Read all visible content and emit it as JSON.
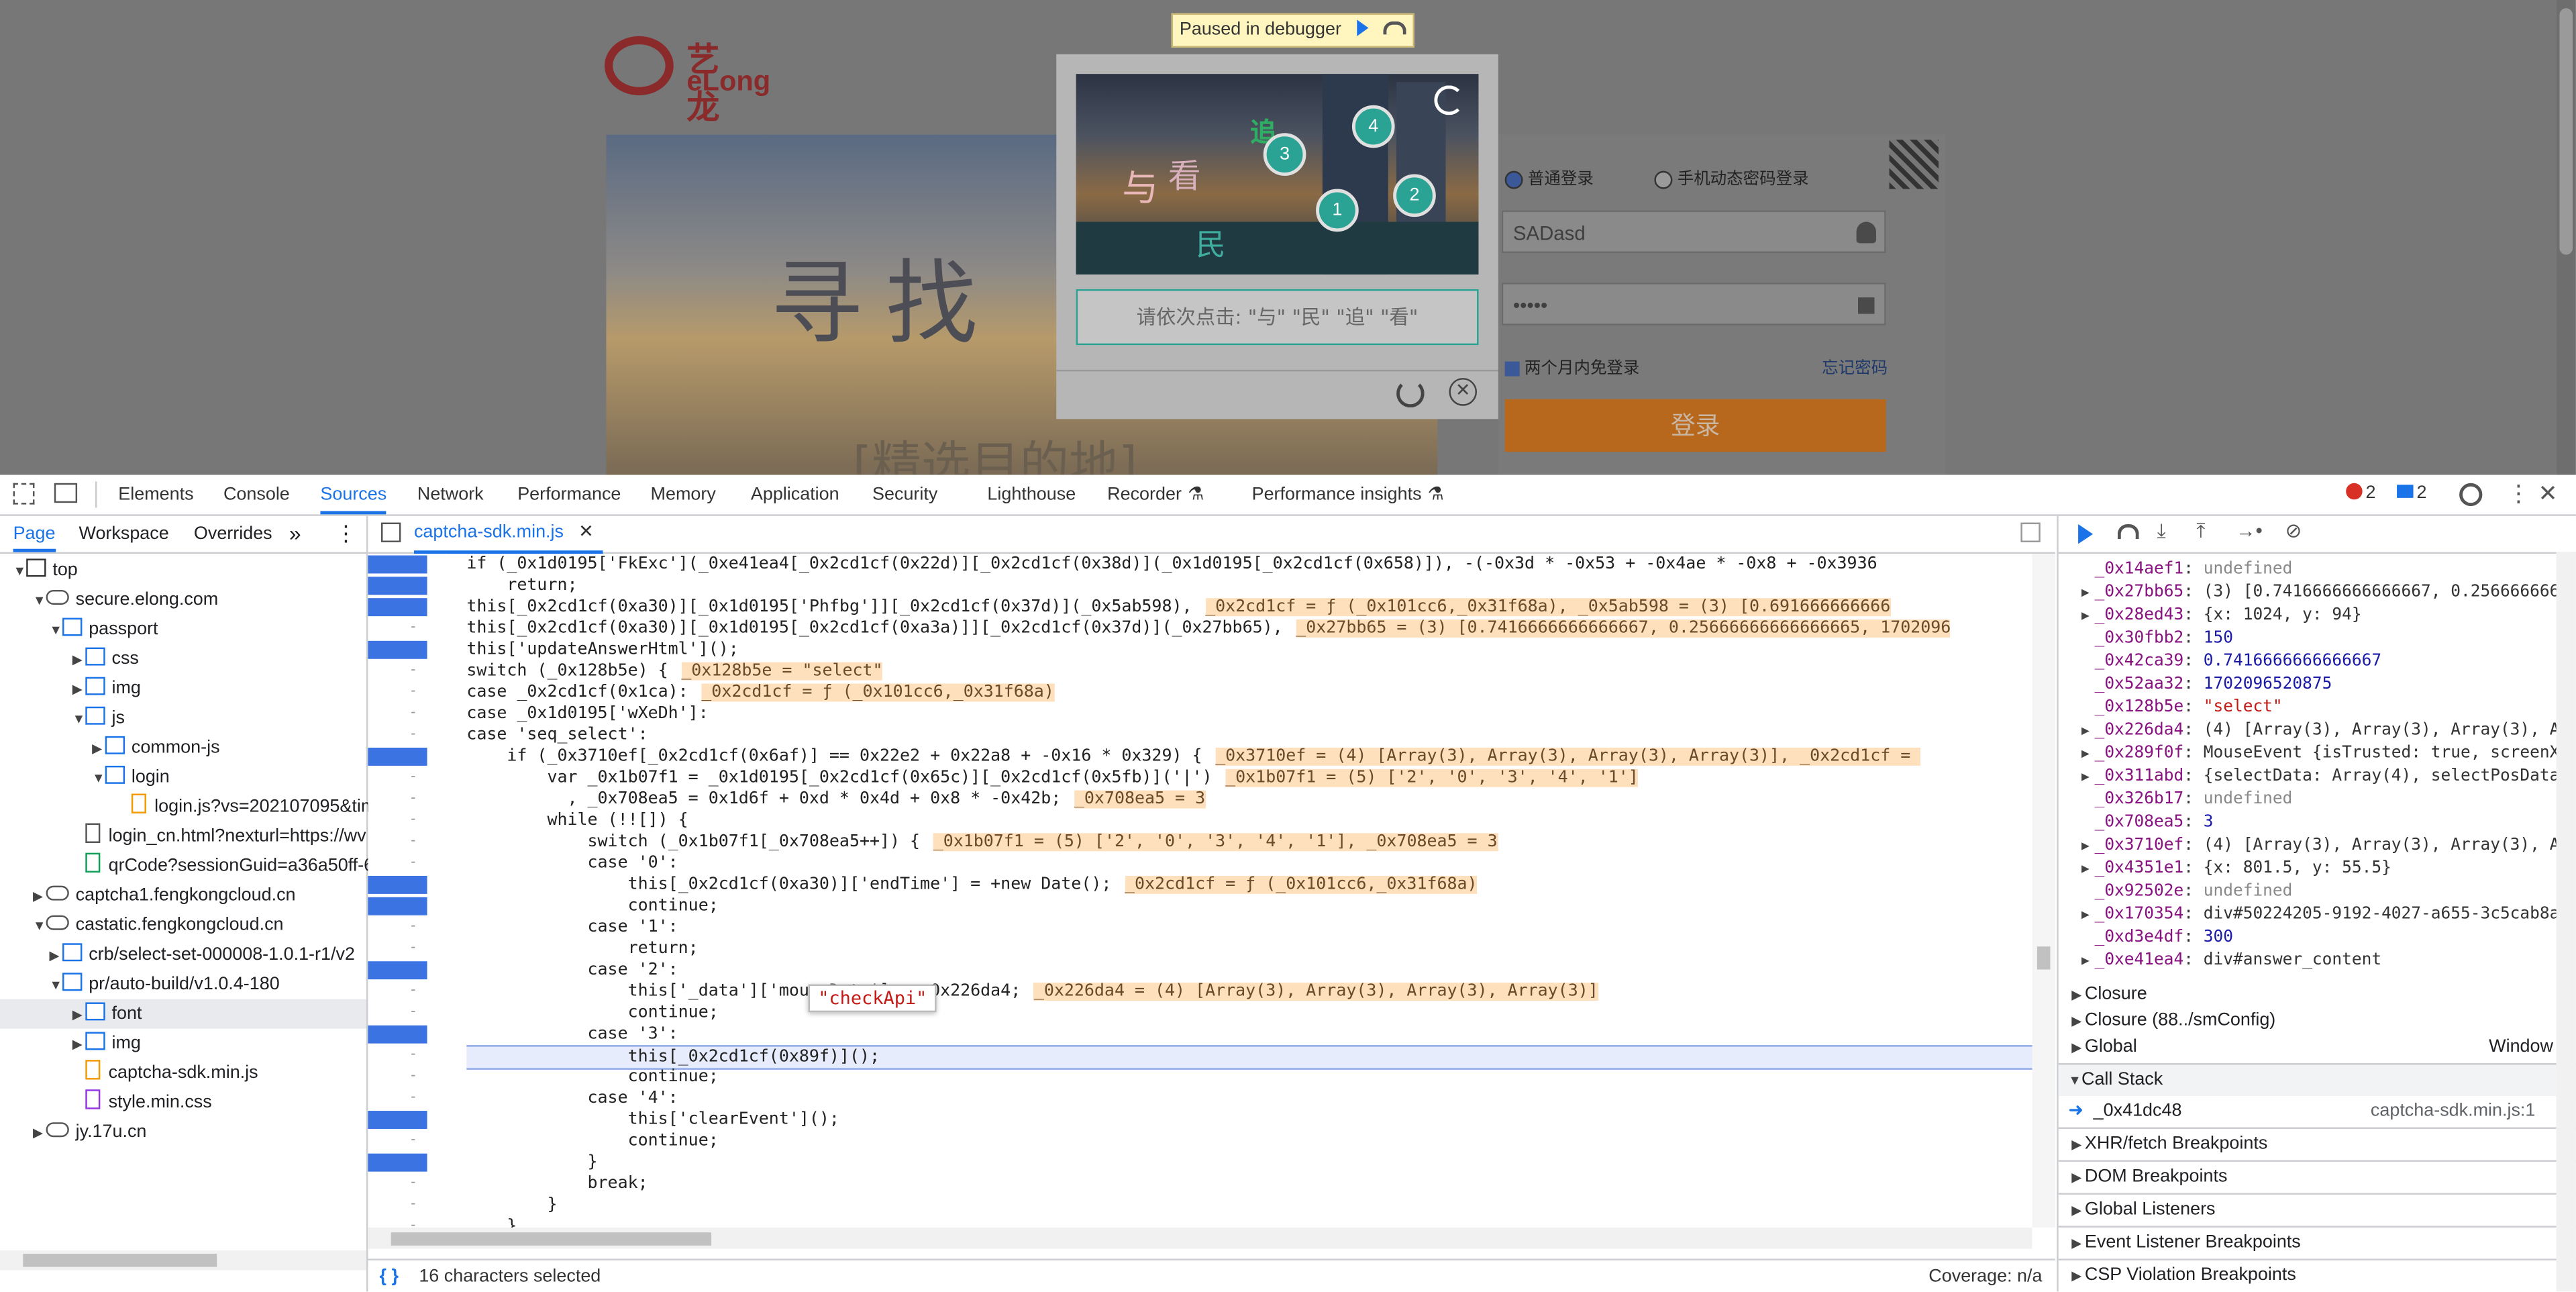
{
  "webpage": {
    "logo_cn": "艺龙",
    "logo_en": "eLong",
    "banner_text": "寻找  下",
    "banner_sub": "[精选目的地]",
    "radio_normal": "普通登录",
    "radio_sms": "手机动态密码登录",
    "username_value": "SADasd",
    "password_value": "•••••",
    "remember_label": "两个月内免登录",
    "forgot_label": "忘记密码",
    "login_button": "登录"
  },
  "debugger_banner": "Paused in debugger",
  "captcha": {
    "hint": "请依次点击: \"与\" \"民\" \"追\" \"看\"",
    "numbers": [
      "3",
      "4",
      "1",
      "2"
    ],
    "chars": [
      "追",
      "与",
      "看",
      "民"
    ]
  },
  "devtools": {
    "tabs": [
      "Elements",
      "Console",
      "Sources",
      "Network",
      "Performance",
      "Memory",
      "Application",
      "Security",
      "Lighthouse",
      "Recorder",
      "Performance insights"
    ],
    "selected_tab": "Sources",
    "error_count": "2",
    "message_count": "2",
    "navigator_tabs": [
      "Page",
      "Workspace",
      "Overrides"
    ],
    "tree": [
      {
        "label": "top",
        "kind": "frame"
      },
      {
        "label": "secure.elong.com",
        "kind": "cloud"
      },
      {
        "label": "passport",
        "kind": "folder"
      },
      {
        "label": "css",
        "kind": "folder"
      },
      {
        "label": "img",
        "kind": "folder"
      },
      {
        "label": "js",
        "kind": "folder"
      },
      {
        "label": "common-js",
        "kind": "folder"
      },
      {
        "label": "login",
        "kind": "folder"
      },
      {
        "label": "login.js?vs=202107095&tim",
        "kind": "js"
      },
      {
        "label": "login_cn.html?nexturl=https://wv",
        "kind": "html"
      },
      {
        "label": "qrCode?sessionGuid=a36a50ff-6",
        "kind": "img"
      },
      {
        "label": "captcha1.fengkongcloud.cn",
        "kind": "cloud"
      },
      {
        "label": "castatic.fengkongcloud.cn",
        "kind": "cloud"
      },
      {
        "label": "crb/select-set-000008-1.0.1-r1/v2",
        "kind": "folder"
      },
      {
        "label": "pr/auto-build/v1.0.4-180",
        "kind": "folder"
      },
      {
        "label": "font",
        "kind": "folder"
      },
      {
        "label": "img",
        "kind": "folder"
      },
      {
        "label": "captcha-sdk.min.js",
        "kind": "js"
      },
      {
        "label": "style.min.css",
        "kind": "css"
      },
      {
        "label": "jy.17u.cn",
        "kind": "cloud"
      }
    ],
    "open_file": "captcha-sdk.min.js",
    "code_lines": [
      "if (_0x1d0195['FkExc'](_0xe41ea4[_0x2cd1cf(0x22d)][_0x2cd1cf(0x38d)](_0x1d0195[_0x2cd1cf(0x658)]), -(-0x3d * -0x53 + -0x4ae * -0x8 + -0x3936",
      "    return;",
      "this[_0x2cd1cf(0xa30)][_0x1d0195['Phfbg']][_0x2cd1cf(0x37d)](_0x5ab598),",
      "this[_0x2cd1cf(0xa30)][_0x1d0195[_0x2cd1cf(0xa3a)]][_0x2cd1cf(0x37d)](_0x27bb65),",
      "this['updateAnswerHtml']();",
      "switch (_0x128b5e) {",
      "case _0x2cd1cf(0x1ca):",
      "case _0x1d0195['wXeDh']:",
      "case 'seq_select':",
      "    if (_0x3710ef[_0x2cd1cf(0x6af)] == 0x22e2 + 0x22a8 + -0x16 * 0x329) {",
      "        var _0x1b07f1 = _0x1d0195[_0x2cd1cf(0x65c)][_0x2cd1cf(0x5fb)]('|')",
      "          , _0x708ea5 = 0x1d6f + 0xd * 0x4d + 0x8 * -0x42b;",
      "        while (!![]) {",
      "            switch (_0x1b07f1[_0x708ea5++]) {",
      "            case '0':",
      "                this[_0x2cd1cf(0xa30)]['endTime'] = +new Date();",
      "                continue;",
      "            case '1':",
      "                return;",
      "            case '2':",
      "                this['_data']['mouseData'] = _0x226da4;",
      "                continue;",
      "            case '3':",
      "                this[_0x2cd1cf(0x89f)]();",
      "                continue;",
      "            case '4':",
      "                this['clearEvent']();",
      "                continue;",
      "            }",
      "            break;",
      "        }",
      "    }"
    ],
    "inline_values": [
      "",
      "",
      "_0x2cd1cf = ƒ (_0x101cc6,_0x31f68a), _0x5ab598 = (3) [0.691666666666",
      "_0x27bb65 = (3) [0.7416666666666667, 0.25666666666666665, 1702096",
      "",
      "_0x128b5e = \"select\"",
      "_0x2cd1cf = ƒ (_0x101cc6,_0x31f68a)",
      "",
      "",
      "_0x3710ef = (4) [Array(3), Array(3), Array(3), Array(3)], _0x2cd1cf = ",
      "_0x1b07f1 = (5) ['2', '0', '3', '4', '1']",
      "_0x708ea5 = 3",
      "",
      "_0x1b07f1 = (5) ['2', '0', '3', '4', '1'], _0x708ea5 = 3",
      "",
      "_0x2cd1cf = ƒ (_0x101cc6,_0x31f68a)",
      "",
      "",
      "",
      "",
      "_0x226da4 = (4) [Array(3), Array(3), Array(3), Array(3)]",
      "",
      "",
      "",
      "",
      "",
      "",
      "",
      "",
      "",
      "",
      ""
    ],
    "tooltip": "\"checkApi\"",
    "status_selected": "16 characters selected",
    "coverage": "Coverage: n/a",
    "scope_vars": [
      {
        "key": "_0x14aef1",
        "val": "undefined",
        "exp": false
      },
      {
        "key": "_0x27bb65",
        "val": "(3) [0.7416666666666667, 0.2566666666",
        "exp": true
      },
      {
        "key": "_0x28ed43",
        "val": "{x: 1024, y: 94}",
        "exp": true
      },
      {
        "key": "_0x30fbb2",
        "val": "150",
        "exp": false
      },
      {
        "key": "_0x42ca39",
        "val": "0.7416666666666667",
        "exp": false
      },
      {
        "key": "_0x52aa32",
        "val": "1702096520875",
        "exp": false
      },
      {
        "key": "_0x128b5e",
        "val": "\"select\"",
        "exp": false
      },
      {
        "key": "_0x226da4",
        "val": "(4) [Array(3), Array(3), Array(3), A",
        "exp": true
      },
      {
        "key": "_0x289f0f",
        "val": "MouseEvent {isTrusted: true, screenX",
        "exp": true
      },
      {
        "key": "_0x311abd",
        "val": "{selectData: Array(4), selectPosData",
        "exp": true
      },
      {
        "key": "_0x326b17",
        "val": "undefined",
        "exp": false
      },
      {
        "key": "_0x708ea5",
        "val": "3",
        "exp": false
      },
      {
        "key": "_0x3710ef",
        "val": "(4) [Array(3), Array(3), Array(3), A",
        "exp": true
      },
      {
        "key": "_0x4351e1",
        "val": "{x: 801.5, y: 55.5}",
        "exp": true
      },
      {
        "key": "_0x92502e",
        "val": "undefined",
        "exp": false
      },
      {
        "key": "_0x170354",
        "val": "div#50224205-9192-4027-a655-3c5cab8a",
        "exp": true
      },
      {
        "key": "_0xd3e4df",
        "val": "300",
        "exp": false
      },
      {
        "key": "_0xe41ea4",
        "val": "div#answer_content",
        "exp": true
      }
    ],
    "closure1": "Closure",
    "closure2": "Closure (88../smConfig)",
    "global": "Global",
    "global_val": "Window",
    "call_stack": "Call Stack",
    "call_frame": "_0x41dc48",
    "call_frame_loc": "captcha-sdk.min.js:1",
    "sections": [
      "XHR/fetch Breakpoints",
      "DOM Breakpoints",
      "Global Listeners",
      "Event Listener Breakpoints",
      "CSP Violation Breakpoints"
    ]
  }
}
